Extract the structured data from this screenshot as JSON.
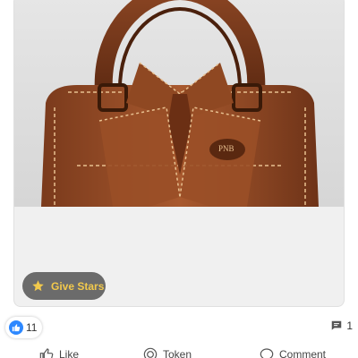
{
  "post": {
    "image": {
      "icon": "leather-bag-photo",
      "emblem_text": "PNB"
    },
    "give_stars": {
      "label": "Give Stars",
      "icon": "star-icon",
      "color": "#f2c94c"
    }
  },
  "reactions": {
    "icon": "like-icon",
    "count": "11",
    "accent": "#2d88ff"
  },
  "comments": {
    "icon": "comment-icon",
    "count": "1"
  },
  "actions": {
    "like_label": "Like",
    "token_label": "Token",
    "comment_label": "Comment"
  }
}
